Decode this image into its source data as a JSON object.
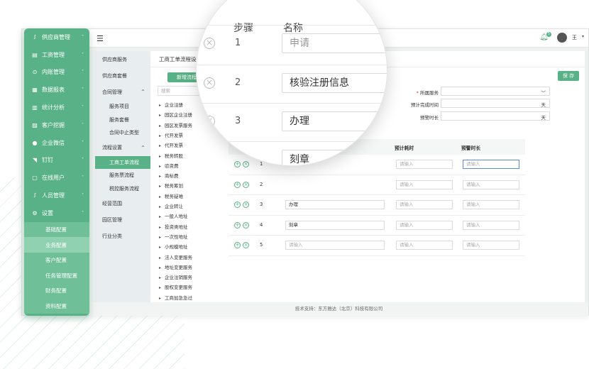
{
  "menu": {
    "items": [
      {
        "icon": "ꭍ",
        "label": "供应商管理"
      },
      {
        "icon": "▤",
        "label": "工资管理"
      },
      {
        "icon": "⊙",
        "label": "内账管理"
      },
      {
        "icon": "▦",
        "label": "数据报表"
      },
      {
        "icon": "▥",
        "label": "统计分析"
      },
      {
        "icon": "▨",
        "label": "客户挖掘"
      },
      {
        "icon": "●",
        "label": "企业微信"
      },
      {
        "icon": "◥",
        "label": "钉钉"
      },
      {
        "icon": "▢",
        "label": "在线用户"
      },
      {
        "icon": "ꭍ",
        "label": "人员管理"
      },
      {
        "icon": "⚙",
        "label": "设置"
      }
    ],
    "settings_sub": [
      "基础配置",
      "业务配置",
      "客户配置",
      "任务管理配置",
      "财务配置",
      "资料配置"
    ],
    "active_sub": "业务配置"
  },
  "header": {
    "bell_count": "5",
    "user_name": "王"
  },
  "nav2": [
    {
      "label": "供应商服务",
      "child": false,
      "caret": ""
    },
    {
      "label": "供应商套餐",
      "child": false,
      "caret": ""
    },
    {
      "label": "合同管理",
      "child": false,
      "caret": "^"
    },
    {
      "label": "服务项目",
      "child": true,
      "caret": ""
    },
    {
      "label": "服务套餐",
      "child": true,
      "caret": ""
    },
    {
      "label": "合同中止类型",
      "child": true,
      "caret": ""
    },
    {
      "label": "流程设置",
      "child": false,
      "caret": "^"
    },
    {
      "label": "工商工单流程",
      "child": true,
      "caret": "",
      "active": true
    },
    {
      "label": "服务票流程",
      "child": true,
      "caret": ""
    },
    {
      "label": "税控服务流程",
      "child": true,
      "caret": ""
    },
    {
      "label": "经营范围",
      "child": false,
      "caret": ""
    },
    {
      "label": "园区管理",
      "child": false,
      "caret": ""
    },
    {
      "label": "行业分类",
      "child": false,
      "caret": ""
    }
  ],
  "main": {
    "title": "工商工单流程设置",
    "new_button": "新增流程",
    "save_button": "保 存",
    "search_placeholder": "搜索",
    "tree": [
      "企业注册",
      "园区企业注册",
      "园区发票服务",
      "代开发票",
      "代开发票",
      "税务转股",
      "验资费",
      "商标费",
      "税务筹划",
      "税务疑难",
      "企业转让",
      "一般人地址",
      "投资类地址",
      "一次性地址",
      "小规模地址",
      "法人变更服务",
      "地址变更服务",
      "企业注销服务",
      "股权变更服务",
      "工商加急急过"
    ],
    "form": [
      {
        "label": "所属服务",
        "required": true,
        "value": "",
        "suffix": "﹀"
      },
      {
        "label": "预计完成时间",
        "required": false,
        "value": "",
        "suffix": "天"
      },
      {
        "label": "预警时长",
        "required": false,
        "value": "",
        "suffix": "天"
      }
    ],
    "table_headers": [
      "预计耗时",
      "预警时长"
    ],
    "rows": [
      {
        "no": "1",
        "name": "",
        "cost": "请输入",
        "warn": "请输入"
      },
      {
        "no": "2",
        "name": "",
        "cost": "请输入",
        "warn": "请输入"
      },
      {
        "no": "3",
        "name": "办理",
        "cost": "请输入",
        "warn": "请输入"
      },
      {
        "no": "4",
        "name": "刻章",
        "cost": "请输入",
        "warn": "请输入"
      },
      {
        "no": "5",
        "name": "请输入",
        "cost": "请输入",
        "warn": "请输入"
      }
    ],
    "footer": "技术支持：东方雅达（北京）科技有限公司"
  },
  "lens": {
    "headers": [
      "步骤",
      "名称"
    ],
    "rows": [
      {
        "no": "1",
        "name": "申请",
        "placeholder": true
      },
      {
        "no": "2",
        "name": "核验注册信息",
        "placeholder": false
      },
      {
        "no": "3",
        "name": "办理",
        "placeholder": false
      },
      {
        "no": "",
        "name": "刻章",
        "placeholder": false
      }
    ]
  },
  "colors": {
    "accent": "#59b287",
    "accent_light": "#8fd1b0"
  }
}
